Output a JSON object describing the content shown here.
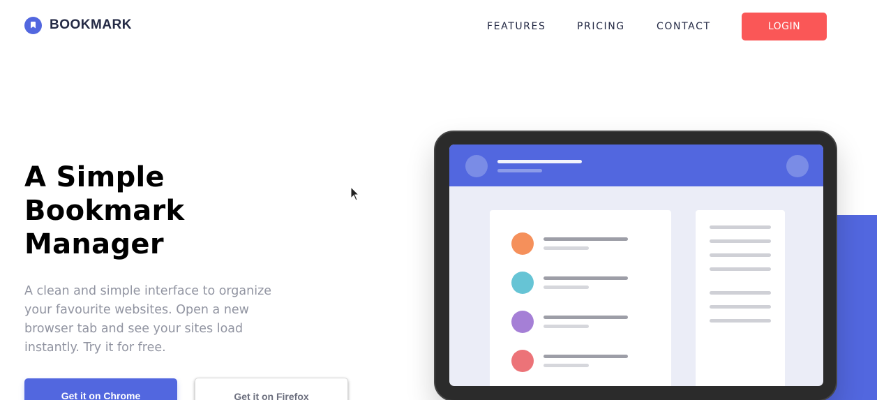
{
  "brand": {
    "name": "BOOKMARK",
    "accent": "#5267df",
    "danger": "#fa5757"
  },
  "nav": {
    "items": [
      {
        "label": "FEATURES"
      },
      {
        "label": "PRICING"
      },
      {
        "label": "CONTACT"
      }
    ],
    "login_label": "LOGIN"
  },
  "hero": {
    "title": "A Simple Bookmark Manager",
    "description": "A clean and simple interface to organize your favourite websites. Open a new browser tab and see your sites load instantly. Try it for free.",
    "buttons": {
      "chrome": "Get it on Chrome",
      "firefox": "Get it on Firefox"
    }
  },
  "illustration": {
    "list_dot_colors": [
      "#f5905b",
      "#66c4d5",
      "#a57fd6",
      "#ec7378"
    ]
  }
}
